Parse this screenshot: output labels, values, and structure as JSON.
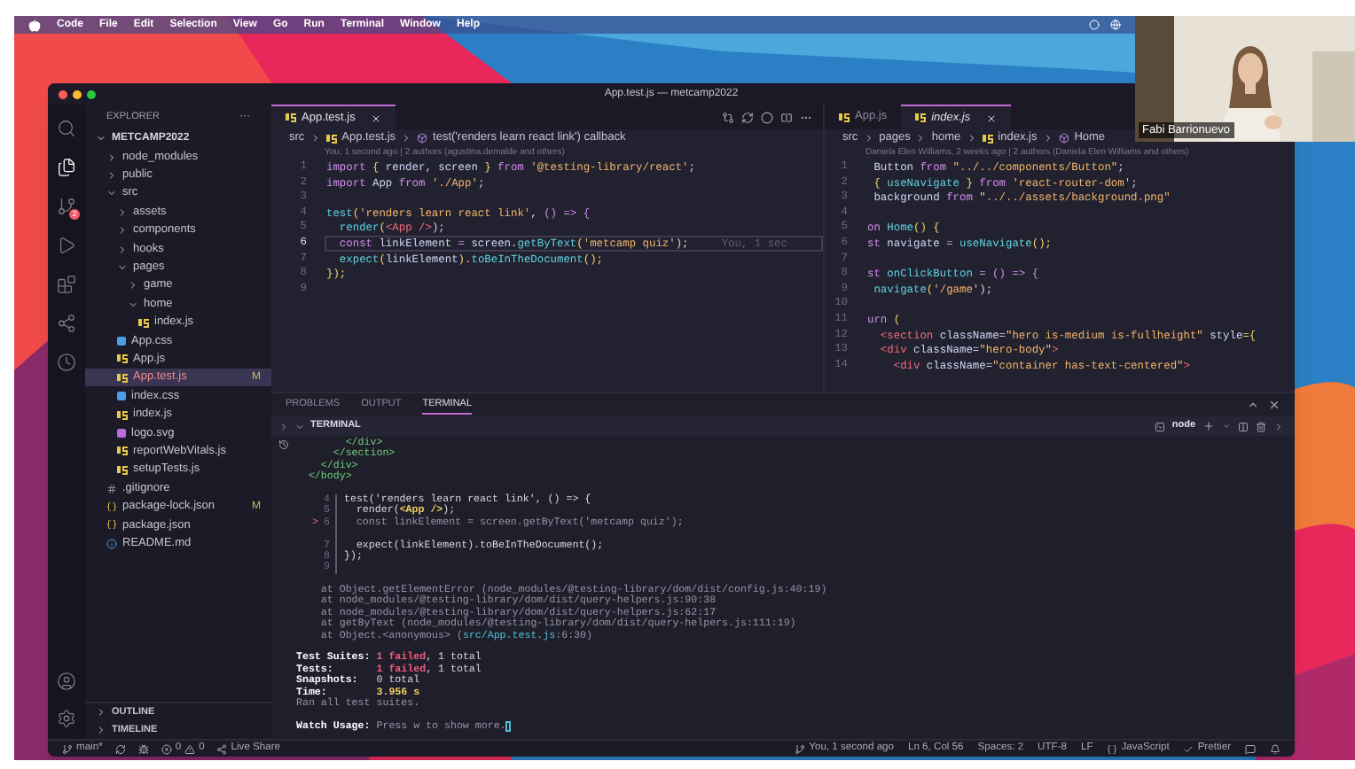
{
  "menu_bar": {
    "items": [
      "Code",
      "File",
      "Edit",
      "Selection",
      "View",
      "Go",
      "Run",
      "Terminal",
      "Window",
      "Help"
    ]
  },
  "video_tile": {
    "name": "Fabi Barrionuevo"
  },
  "window": {
    "title": "App.test.js — metcamp2022"
  },
  "activity_bar": {
    "items": [
      {
        "kind": "search",
        "selected": false
      },
      {
        "kind": "files",
        "selected": true
      },
      {
        "kind": "scm",
        "selected": false,
        "badge": "2"
      },
      {
        "kind": "run",
        "selected": false
      },
      {
        "kind": "extensions",
        "selected": false
      },
      {
        "kind": "share",
        "selected": false
      },
      {
        "kind": "timer",
        "selected": false
      }
    ],
    "bottom": [
      {
        "kind": "account"
      },
      {
        "kind": "settings"
      }
    ]
  },
  "sidebar": {
    "title": "EXPLORER",
    "more": "···",
    "root": {
      "label": "METCAMP2022",
      "expanded": true
    },
    "items": [
      {
        "label": "node_modules",
        "kind": "folder",
        "expanded": false,
        "selected": false
      },
      {
        "label": "public",
        "kind": "folder",
        "expanded": false,
        "selected": false
      },
      {
        "label": "src",
        "kind": "folder",
        "expanded": true,
        "selected": false,
        "children": [
          {
            "label": "assets",
            "kind": "folder",
            "expanded": false,
            "selected": false
          },
          {
            "label": "components",
            "kind": "folder",
            "expanded": false,
            "selected": false
          },
          {
            "label": "hooks",
            "kind": "folder",
            "expanded": false,
            "selected": false
          },
          {
            "label": "pages",
            "kind": "folder",
            "expanded": true,
            "selected": false,
            "children": [
              {
                "label": "game",
                "kind": "folder",
                "expanded": false,
                "selected": false
              },
              {
                "label": "home",
                "kind": "folder",
                "expanded": true,
                "selected": false,
                "children": [
                  {
                    "label": "index.js",
                    "kind": "js",
                    "selected": false
                  }
                ]
              }
            ]
          },
          {
            "label": "App.css",
            "kind": "css",
            "selected": false
          },
          {
            "label": "App.js",
            "kind": "js",
            "selected": false
          },
          {
            "label": "App.test.js",
            "kind": "js",
            "selected": true,
            "badge": "M"
          },
          {
            "label": "index.css",
            "kind": "css",
            "selected": false
          },
          {
            "label": "index.js",
            "kind": "js",
            "selected": false
          },
          {
            "label": "logo.svg",
            "kind": "svg",
            "selected": false
          },
          {
            "label": "reportWebVitals.js",
            "kind": "js",
            "selected": false
          },
          {
            "label": "setupTests.js",
            "kind": "js",
            "selected": false
          }
        ]
      },
      {
        "label": ".gitignore",
        "kind": "git",
        "selected": false
      },
      {
        "label": "package-lock.json",
        "kind": "json",
        "selected": false,
        "badge": "M"
      },
      {
        "label": "package.json",
        "kind": "json",
        "selected": false
      },
      {
        "label": "README.md",
        "kind": "md",
        "selected": false
      }
    ],
    "sections": [
      "OUTLINE",
      "TIMELINE"
    ]
  },
  "editor_left": {
    "tabs": [
      {
        "label": "App.test.js",
        "selected": true
      }
    ],
    "breadcrumbs": [
      {
        "kind": "folder",
        "text": "src"
      },
      {
        "kind": "js",
        "text": "App.test.js"
      },
      {
        "kind": "symbol",
        "text": "test('renders learn react link') callback"
      }
    ],
    "blame": "You, 1 second ago | 2 authors (agustina.demalde and others)",
    "lines": [
      {
        "number": "1",
        "current": false,
        "tokens": [
          {
            "text": "import",
            "kind": "kw"
          },
          {
            "text": " { ",
            "kind": "punc"
          },
          {
            "text": "render, screen",
            "kind": "var"
          },
          {
            "text": " } ",
            "kind": "punc"
          },
          {
            "text": "from ",
            "kind": "kw"
          },
          {
            "text": "'@testing-library/react'",
            "kind": "str"
          },
          {
            "text": ";",
            "kind": "plain"
          }
        ]
      },
      {
        "number": "2",
        "current": false,
        "tokens": [
          {
            "text": "import ",
            "kind": "kw"
          },
          {
            "text": "App ",
            "kind": "var"
          },
          {
            "text": "from ",
            "kind": "kw"
          },
          {
            "text": "'./App'",
            "kind": "str"
          },
          {
            "text": ";",
            "kind": "plain"
          }
        ]
      },
      {
        "number": "3",
        "current": false
      },
      {
        "number": "4",
        "current": false,
        "tokens": [
          {
            "text": "test",
            "kind": "fn"
          },
          {
            "text": "(",
            "kind": "punc"
          },
          {
            "text": "'renders learn react link'",
            "kind": "str"
          },
          {
            "text": ", ",
            "kind": "plain"
          },
          {
            "text": "() => {",
            "kind": "kw"
          }
        ]
      },
      {
        "number": "5",
        "current": false,
        "tokens": [
          {
            "text": "  render",
            "kind": "fn"
          },
          {
            "text": "(",
            "kind": "punc"
          },
          {
            "text": "<App />",
            "kind": "tag"
          },
          {
            "text": ");",
            "kind": "plain"
          }
        ]
      },
      {
        "number": "6",
        "current": true,
        "blame": "You, 1 sec",
        "tokens": [
          {
            "text": "  const ",
            "kind": "kw"
          },
          {
            "text": "linkElement ",
            "kind": "var"
          },
          {
            "text": "= ",
            "kind": "kw"
          },
          {
            "text": "screen.",
            "kind": "var"
          },
          {
            "text": "getByText",
            "kind": "fn"
          },
          {
            "text": "(",
            "kind": "punc"
          },
          {
            "text": "'metcamp quiz'",
            "kind": "str"
          },
          {
            "text": ");",
            "kind": "plain"
          }
        ]
      },
      {
        "number": "7",
        "current": false,
        "tokens": [
          {
            "text": "  expect",
            "kind": "fn"
          },
          {
            "text": "(",
            "kind": "punc"
          },
          {
            "text": "linkElement",
            "kind": "var"
          },
          {
            "text": ").",
            "kind": "punc"
          },
          {
            "text": "toBeInTheDocument",
            "kind": "fn"
          },
          {
            "text": "();",
            "kind": "punc"
          }
        ]
      },
      {
        "number": "8",
        "current": false,
        "tokens": [
          {
            "text": "});",
            "kind": "punc"
          }
        ]
      },
      {
        "number": "9",
        "current": false
      }
    ]
  },
  "editor_right": {
    "tabs": [
      {
        "label": "App.js",
        "selected": false
      },
      {
        "label": "index.js",
        "selected": true
      }
    ],
    "breadcrumbs": [
      {
        "kind": "folder",
        "text": "src"
      },
      {
        "kind": "folder",
        "text": "pages"
      },
      {
        "kind": "folder",
        "text": "home"
      },
      {
        "kind": "js",
        "text": "index.js"
      },
      {
        "kind": "symbol",
        "text": "Home"
      }
    ],
    "blame": "Daniela Elen Williams, 2 weeks ago | 2 authors (Daniela Elen Williams and others)",
    "lines": [
      {
        "number": "1",
        "tokens": [
          {
            "text": " Button ",
            "kind": "var"
          },
          {
            "text": "from ",
            "kind": "kw"
          },
          {
            "text": "\"../../components/Button\"",
            "kind": "str"
          },
          {
            "text": ";",
            "kind": "plain"
          }
        ]
      },
      {
        "number": "2",
        "tokens": [
          {
            "text": " { ",
            "kind": "punc"
          },
          {
            "text": "useNavigate",
            "kind": "fn"
          },
          {
            "text": " } ",
            "kind": "punc"
          },
          {
            "text": "from ",
            "kind": "kw"
          },
          {
            "text": "'react-router-dom'",
            "kind": "str"
          },
          {
            "text": ";",
            "kind": "plain"
          }
        ]
      },
      {
        "number": "3",
        "tokens": [
          {
            "text": " background ",
            "kind": "var"
          },
          {
            "text": "from ",
            "kind": "kw"
          },
          {
            "text": "\"../../assets/background.png\"",
            "kind": "str"
          }
        ]
      },
      {
        "number": "4"
      },
      {
        "number": "5",
        "tokens": [
          {
            "text": "on ",
            "kind": "kw"
          },
          {
            "text": "Home",
            "kind": "fn"
          },
          {
            "text": "() {",
            "kind": "punc"
          }
        ]
      },
      {
        "number": "6",
        "tokens": [
          {
            "text": "st ",
            "kind": "kw"
          },
          {
            "text": "navigate ",
            "kind": "var"
          },
          {
            "text": "= ",
            "kind": "kw"
          },
          {
            "text": "useNavigate",
            "kind": "fn"
          },
          {
            "text": "();",
            "kind": "punc"
          }
        ]
      },
      {
        "number": "7"
      },
      {
        "number": "8",
        "tokens": [
          {
            "text": "st ",
            "kind": "kw"
          },
          {
            "text": "onClickButton ",
            "kind": "fn"
          },
          {
            "text": "= () => {",
            "kind": "kw"
          }
        ]
      },
      {
        "number": "9",
        "tokens": [
          {
            "text": " navigate",
            "kind": "fn"
          },
          {
            "text": "(",
            "kind": "punc"
          },
          {
            "text": "'/game'",
            "kind": "str"
          },
          {
            "text": ");",
            "kind": "plain"
          }
        ]
      },
      {
        "number": "10"
      },
      {
        "number": "11",
        "tokens": [
          {
            "text": "urn ",
            "kind": "kw"
          },
          {
            "text": "(",
            "kind": "punc"
          }
        ]
      },
      {
        "number": "12",
        "tokens": [
          {
            "text": "  <section ",
            "kind": "tag"
          },
          {
            "text": "className",
            "kind": "var"
          },
          {
            "text": "=",
            "kind": "plain"
          },
          {
            "text": "\"hero is-medium is-fullheight\" ",
            "kind": "str"
          },
          {
            "text": "style",
            "kind": "var"
          },
          {
            "text": "={",
            "kind": "punc"
          }
        ]
      },
      {
        "number": "13",
        "tokens": [
          {
            "text": "  <div ",
            "kind": "tag"
          },
          {
            "text": "className",
            "kind": "var"
          },
          {
            "text": "=",
            "kind": "plain"
          },
          {
            "text": "\"hero-body\"",
            "kind": "str"
          },
          {
            "text": ">",
            "kind": "tag"
          }
        ]
      },
      {
        "number": "14",
        "tokens": [
          {
            "text": "    <div ",
            "kind": "tag"
          },
          {
            "text": "className",
            "kind": "var"
          },
          {
            "text": "=",
            "kind": "plain"
          },
          {
            "text": "\"container has-text-centered\"",
            "kind": "str"
          },
          {
            "text": ">",
            "kind": "tag"
          }
        ]
      }
    ]
  },
  "panel": {
    "tabs": [
      {
        "label": "PROBLEMS",
        "selected": false
      },
      {
        "label": "OUTPUT",
        "selected": false
      },
      {
        "label": "TERMINAL",
        "selected": true
      }
    ],
    "section": "TERMINAL",
    "shell": "node",
    "lines": [
      {
        "kind": "text",
        "tokens": [
          {
            "text": "        </div>",
            "kind": "html"
          }
        ]
      },
      {
        "kind": "text",
        "tokens": [
          {
            "text": "      </section>",
            "kind": "html"
          }
        ]
      },
      {
        "kind": "text",
        "tokens": [
          {
            "text": "    </div>",
            "kind": "html"
          }
        ]
      },
      {
        "kind": "text",
        "tokens": [
          {
            "text": "  </body>",
            "kind": "html"
          }
        ]
      },
      {
        "kind": "blank"
      },
      {
        "kind": "snippet",
        "number": "4",
        "tokens": [
          {
            "text": "test('renders learn react link', () => {",
            "kind": "bright"
          }
        ]
      },
      {
        "kind": "snippet",
        "number": "5",
        "tokens": [
          {
            "text": "  render(",
            "kind": "bright"
          },
          {
            "text": "<App />",
            "kind": "yellow"
          },
          {
            "text": ");",
            "kind": "bright"
          }
        ]
      },
      {
        "kind": "snippet",
        "number": "6",
        "pointer": ">",
        "tokens": [
          {
            "text": "  const linkElement = screen.getByText('metcamp quiz');",
            "kind": "dim"
          }
        ]
      },
      {
        "kind": "snippet"
      },
      {
        "kind": "snippet",
        "number": "7",
        "tokens": [
          {
            "text": "  expect(linkElement).toBeInTheDocument();",
            "kind": "bright"
          }
        ]
      },
      {
        "kind": "snippet",
        "number": "8",
        "tokens": [
          {
            "text": "});",
            "kind": "bright"
          }
        ]
      },
      {
        "kind": "snippet",
        "number": "9"
      },
      {
        "kind": "blank"
      },
      {
        "kind": "text",
        "tokens": [
          {
            "text": "    at Object.getElementError (node_modules/@testing-library/dom/dist/config.js:40:19)",
            "kind": "dim"
          }
        ]
      },
      {
        "kind": "text",
        "tokens": [
          {
            "text": "    at node_modules/@testing-library/dom/dist/query-helpers.js:90:38",
            "kind": "dim"
          }
        ]
      },
      {
        "kind": "text",
        "tokens": [
          {
            "text": "    at node_modules/@testing-library/dom/dist/query-helpers.js:62:17",
            "kind": "dim"
          }
        ]
      },
      {
        "kind": "text",
        "tokens": [
          {
            "text": "    at getByText (node_modules/@testing-library/dom/dist/query-helpers.js:111:19)",
            "kind": "dim"
          }
        ]
      },
      {
        "kind": "text",
        "tokens": [
          {
            "text": "    at Object.<anonymous> (",
            "kind": "dim"
          },
          {
            "text": "src/App.test.js",
            "kind": "path"
          },
          {
            "text": ":6:30)",
            "kind": "dim"
          }
        ]
      },
      {
        "kind": "blank"
      },
      {
        "kind": "text",
        "tokens": [
          {
            "text": "Test Suites: ",
            "kind": "bold"
          },
          {
            "text": "1 failed",
            "kind": "fail"
          },
          {
            "text": ", 1 total",
            "kind": "bright"
          }
        ]
      },
      {
        "kind": "text",
        "tokens": [
          {
            "text": "Tests:       ",
            "kind": "bold"
          },
          {
            "text": "1 failed",
            "kind": "fail"
          },
          {
            "text": ", 1 total",
            "kind": "bright"
          }
        ]
      },
      {
        "kind": "text",
        "tokens": [
          {
            "text": "Snapshots:   ",
            "kind": "bold"
          },
          {
            "text": "0 total",
            "kind": "bright"
          }
        ]
      },
      {
        "kind": "text",
        "tokens": [
          {
            "text": "Time:        ",
            "kind": "bold"
          },
          {
            "text": "3.956 s",
            "kind": "yellow"
          }
        ]
      },
      {
        "kind": "text",
        "tokens": [
          {
            "text": "Ran all test suites.",
            "kind": "dim"
          }
        ]
      },
      {
        "kind": "blank"
      },
      {
        "kind": "prompt",
        "tokens": [
          {
            "text": "Watch Usage: ",
            "kind": "bold"
          },
          {
            "text": "Press w to show more.",
            "kind": "dim"
          }
        ]
      }
    ]
  },
  "status_bar": {
    "left": [
      {
        "kind": "branch",
        "text": "main*"
      },
      {
        "kind": "sync"
      },
      {
        "kind": "debug"
      },
      {
        "kind": "problems",
        "errors": "0",
        "warnings": "0"
      },
      {
        "kind": "share",
        "text": "Live Share"
      }
    ],
    "right": [
      {
        "kind": "blame",
        "text": "You, 1 second ago"
      },
      {
        "kind": "text",
        "text": "Ln 6, Col 56"
      },
      {
        "kind": "text",
        "text": "Spaces: 2"
      },
      {
        "kind": "text",
        "text": "UTF-8"
      },
      {
        "kind": "text",
        "text": "LF"
      },
      {
        "kind": "language",
        "text": "JavaScript"
      },
      {
        "kind": "prettier",
        "text": "Prettier"
      },
      {
        "kind": "feedback"
      },
      {
        "kind": "bell"
      }
    ]
  }
}
